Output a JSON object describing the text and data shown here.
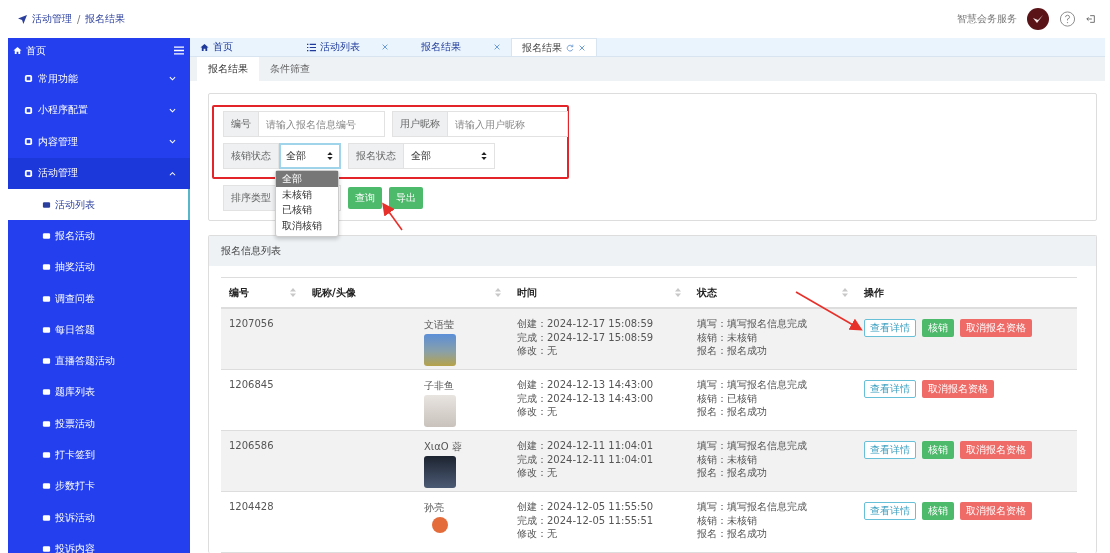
{
  "breadcrumb": {
    "items": [
      "活动管理",
      "报名结果"
    ],
    "separator": "/"
  },
  "header": {
    "org_name": "智慧会务服务"
  },
  "sidebar": {
    "title": "首页",
    "items": [
      {
        "label": "常用功能",
        "expanded": false
      },
      {
        "label": "小程序配置",
        "expanded": false
      },
      {
        "label": "内容管理",
        "expanded": false
      },
      {
        "label": "活动管理",
        "expanded": true,
        "children": [
          {
            "label": "活动列表",
            "selected": true
          },
          {
            "label": "报名活动",
            "selected": false
          },
          {
            "label": "抽奖活动",
            "selected": false
          },
          {
            "label": "调查问卷",
            "selected": false
          },
          {
            "label": "每日答题",
            "selected": false
          },
          {
            "label": "直播答题活动",
            "selected": false
          },
          {
            "label": "题库列表",
            "selected": false
          },
          {
            "label": "投票活动",
            "selected": false
          },
          {
            "label": "打卡签到",
            "selected": false
          },
          {
            "label": "步数打卡",
            "selected": false
          },
          {
            "label": "投诉活动",
            "selected": false
          },
          {
            "label": "投诉内容",
            "selected": false
          }
        ]
      }
    ]
  },
  "tabs": [
    {
      "label": "首页",
      "kind": "home",
      "closable": false,
      "selected": false
    },
    {
      "label": "活动列表",
      "kind": "list",
      "closable": true,
      "selected": false
    },
    {
      "label": "报名结果",
      "kind": "plain",
      "closable": true,
      "selected": false
    },
    {
      "label": "报名结果",
      "kind": "plain",
      "closable": true,
      "selected": true
    }
  ],
  "subtabs": [
    {
      "label": "报名结果",
      "selected": true
    },
    {
      "label": "条件筛查",
      "selected": false
    }
  ],
  "filters": {
    "rows": [
      [
        {
          "label": "编号",
          "kind": "input",
          "placeholder": "请输入报名信息编号"
        },
        {
          "label": "用户昵称",
          "kind": "input",
          "placeholder": "请输入用户昵称"
        }
      ],
      [
        {
          "label": "核销状态",
          "kind": "select",
          "value": "全部",
          "focused": true
        },
        {
          "label": "报名状态",
          "kind": "select",
          "value": "全部",
          "focused": false
        }
      ]
    ],
    "sort": {
      "label": "排序类型"
    },
    "buttons": [
      "查询",
      "导出"
    ],
    "dropdown": [
      {
        "label": "全部",
        "selected": true
      },
      {
        "label": "未核销",
        "selected": false
      },
      {
        "label": "已核销",
        "selected": false
      },
      {
        "label": "取消核销",
        "selected": false
      }
    ]
  },
  "list": {
    "title": "报名信息列表",
    "columns": [
      {
        "label": "编号",
        "sortable": true
      },
      {
        "label": "昵称/头像",
        "sortable": true
      },
      {
        "label": "时间",
        "sortable": true
      },
      {
        "label": "状态",
        "sortable": true
      },
      {
        "label": "操作",
        "sortable": false
      }
    ],
    "rows": [
      {
        "id": "1207056",
        "nickname": "文语莹",
        "time": [
          "创建：2024-12-17 15:08:59",
          "完成：2024-12-17 15:08:59",
          "修改：无"
        ],
        "status": [
          "填写：填写报名信息完成",
          "核销：未核销",
          "报名：报名成功"
        ],
        "actions": [
          {
            "label": "查看详情",
            "kind": "detail"
          },
          {
            "label": "核销",
            "kind": "verify"
          },
          {
            "label": "取消报名资格",
            "kind": "cancel"
          }
        ]
      },
      {
        "id": "1206845",
        "nickname": "子非鱼",
        "time": [
          "创建：2024-12-13 14:43:00",
          "完成：2024-12-13 14:43:00",
          "修改：无"
        ],
        "status": [
          "填写：填写报名信息完成",
          "核销：已核销",
          "报名：报名成功"
        ],
        "actions": [
          {
            "label": "查看详情",
            "kind": "detail"
          },
          {
            "label": "取消报名资格",
            "kind": "cancel"
          }
        ]
      },
      {
        "id": "1206586",
        "nickname": "XιαO 蓉",
        "time": [
          "创建：2024-12-11 11:04:01",
          "完成：2024-12-11 11:04:01",
          "修改：无"
        ],
        "status": [
          "填写：填写报名信息完成",
          "核销：未核销",
          "报名：报名成功"
        ],
        "actions": [
          {
            "label": "查看详情",
            "kind": "detail"
          },
          {
            "label": "核销",
            "kind": "verify"
          },
          {
            "label": "取消报名资格",
            "kind": "cancel"
          }
        ]
      },
      {
        "id": "1204428",
        "nickname": "孙亮",
        "time": [
          "创建：2024-12-05 11:55:50",
          "完成：2024-12-05 11:55:51",
          "修改：无"
        ],
        "status": [
          "填写：填写报名信息完成",
          "核销：未核销",
          "报名：报名成功"
        ],
        "actions": [
          {
            "label": "查看详情",
            "kind": "detail"
          },
          {
            "label": "核销",
            "kind": "verify"
          },
          {
            "label": "取消报名资格",
            "kind": "cancel"
          }
        ]
      }
    ]
  }
}
